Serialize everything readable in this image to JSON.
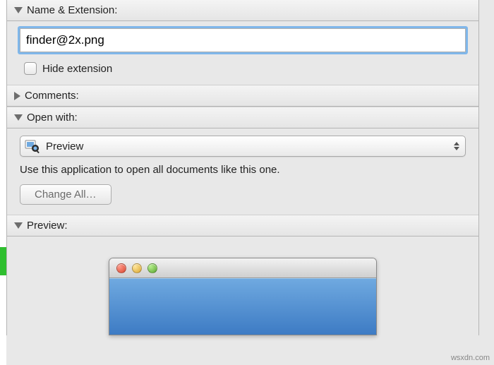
{
  "sections": {
    "name_extension": {
      "title": "Name & Extension:",
      "filename_value": "finder@2x.png",
      "hide_extension_label": "Hide extension"
    },
    "comments": {
      "title": "Comments:"
    },
    "open_with": {
      "title": "Open with:",
      "app_label": "Preview",
      "help_text": "Use this application to open all documents like this one.",
      "change_all_label": "Change All…"
    },
    "preview": {
      "title": "Preview:"
    }
  },
  "watermark": "wsxdn.com"
}
